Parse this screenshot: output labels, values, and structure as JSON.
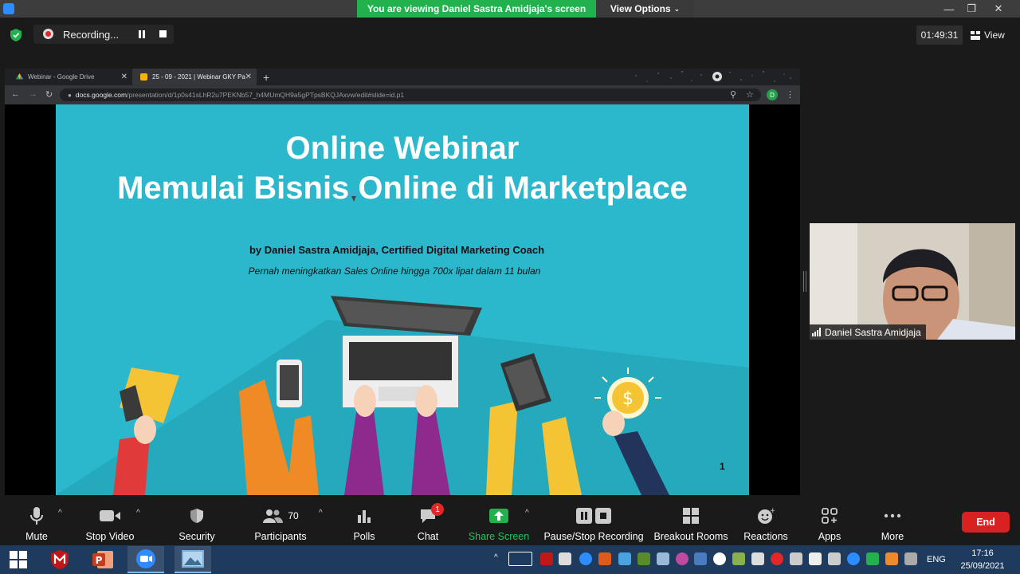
{
  "zoom": {
    "banner": "You are viewing Daniel Sastra Amidjaja's screen",
    "view_options": "View Options",
    "recording_label": "Recording...",
    "timer": "01:49:31",
    "view_label": "View",
    "accent_green": "#23b14d",
    "end_red": "#d92121"
  },
  "browser": {
    "tabs": [
      {
        "label": "Webinar - Google Drive",
        "icon": "google-drive-icon"
      },
      {
        "label": "25 - 09 - 2021 | Webinar GKY Pa",
        "icon": "google-slides-icon"
      }
    ],
    "url_host": "docs.google.com",
    "url_path": "/presentation/d/1p0s41sLhR2u7PEKNb57_h4MUmQH9a5gPTpsBKQJAxvw/edit#slide=id.p1",
    "profile_initial": "D"
  },
  "slide": {
    "title_line1": "Online Webinar",
    "title_line2": "Memulai Bisnis Online di Marketplace",
    "byline": "by Daniel Sastra Amidjaja, Certified Digital Marketing Coach",
    "tagline": "Pernah meningkatkan Sales Online hingga 700x lipat dalam 11 bulan",
    "page_number": "1",
    "background": "#2cb8cc"
  },
  "participant": {
    "name": "Daniel Sastra Amidjaja"
  },
  "toolbar": {
    "mute": "Mute",
    "stop_video": "Stop Video",
    "security": "Security",
    "participants": "Participants",
    "participants_count": "70",
    "polls": "Polls",
    "chat": "Chat",
    "chat_badge": "1",
    "share_screen": "Share Screen",
    "pause_recording": "Pause/Stop Recording",
    "breakout_rooms": "Breakout Rooms",
    "reactions": "Reactions",
    "apps": "Apps",
    "more": "More",
    "end": "End"
  },
  "taskbar": {
    "language": "ENG",
    "time": "17:16",
    "date": "25/09/2021"
  }
}
